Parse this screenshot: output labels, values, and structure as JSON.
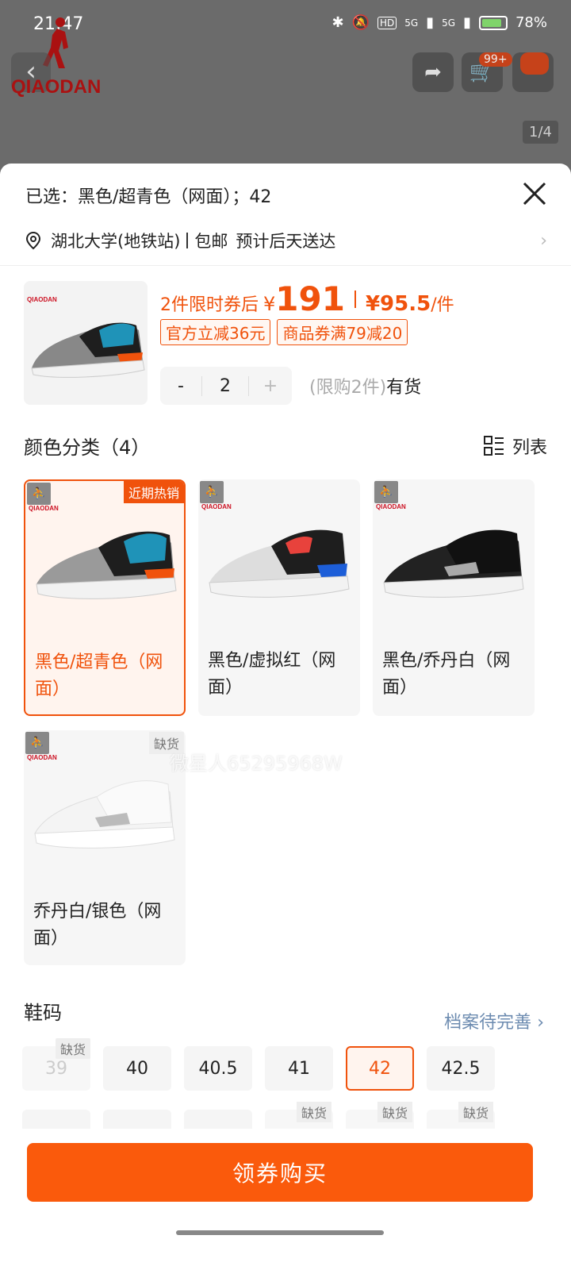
{
  "status_bar": {
    "time": "21:47",
    "signal_1": "5G",
    "signal_2": "5G",
    "battery": "78%"
  },
  "background": {
    "brand": "QIAODAN",
    "cart_badge": "99+",
    "pager": "1/4"
  },
  "sheet": {
    "selected_text": "已选：黑色/超青色（网面）；42",
    "close_icon": "close-icon",
    "address": {
      "location": "湖北大学(地铁站)",
      "shipping": "包邮",
      "delivery": "预计后天送达"
    }
  },
  "product": {
    "price_prefix": "2件限时券后",
    "currency": "¥",
    "price": "191",
    "unit_price": "¥95.5",
    "unit_suffix": "/件",
    "coupons": [
      "官方立减36元",
      "商品券满79减20"
    ],
    "quantity": "2",
    "minus": "-",
    "plus": "+",
    "limit_text": "(限购2件)",
    "stock_text": "有货"
  },
  "colors": {
    "title": "颜色分类（4）",
    "list_label": "列表",
    "items": [
      {
        "label": "黑色/超青色（网面）",
        "tag": "近期热销",
        "selected": true
      },
      {
        "label": "黑色/虚拟红（网面）",
        "tag": "",
        "selected": false
      },
      {
        "label": "黑色/乔丹白（网面）",
        "tag": "",
        "selected": false
      },
      {
        "label": "乔丹白/银色（网面）",
        "tag": "缺货",
        "selected": false
      }
    ]
  },
  "sizes": {
    "title": "鞋码",
    "profile_link": "档案待完善",
    "row1": [
      {
        "label": "39",
        "tag": "缺货",
        "state": "disabled"
      },
      {
        "label": "40",
        "tag": "",
        "state": "normal"
      },
      {
        "label": "40.5",
        "tag": "",
        "state": "normal"
      },
      {
        "label": "41",
        "tag": "",
        "state": "normal"
      },
      {
        "label": "42",
        "tag": "",
        "state": "selected"
      },
      {
        "label": "42.5",
        "tag": "",
        "state": "normal"
      }
    ],
    "row2_tags": [
      "缺货",
      "缺货",
      "缺货"
    ]
  },
  "watermark": "微星人65295968W",
  "buy_button": "领券购买",
  "colors_palette": {
    "accent": "#f0520c",
    "button": "#fa5a0c",
    "link": "#6c8bb0"
  }
}
